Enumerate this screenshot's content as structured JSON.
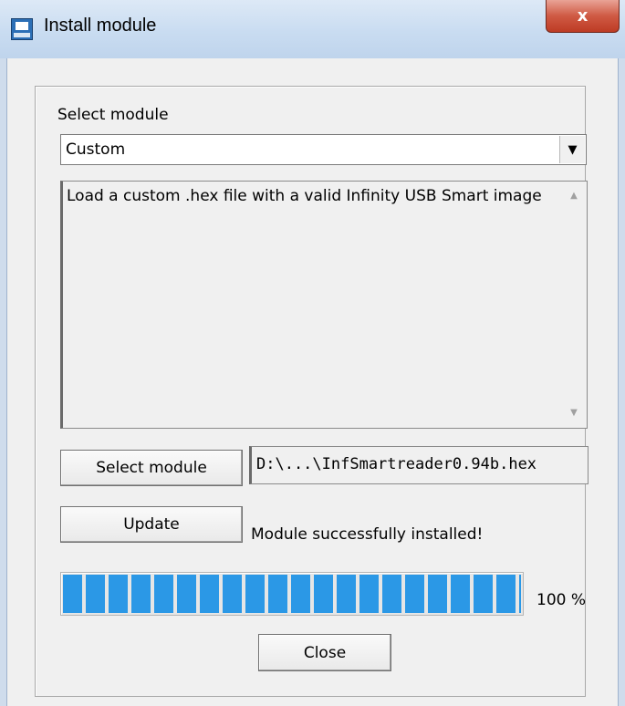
{
  "window": {
    "title": "Install module",
    "close_glyph": "x",
    "app_icon": "install-module-app-icon"
  },
  "form": {
    "select_module_label": "Select module",
    "module_select": {
      "selected": "Custom",
      "arrow_icon": "chevron-down-icon"
    },
    "description": "Load a custom .hex file with a valid Infinity USB Smart image",
    "select_module_button": "Select module",
    "file_path": "D:\\...\\InfSmartreader0.94b.hex",
    "update_button": "Update",
    "status": "Module successfully installed!",
    "progress": {
      "value": 100,
      "text": "100 %",
      "fill_color": "#2b98e6"
    },
    "close_button": "Close"
  }
}
